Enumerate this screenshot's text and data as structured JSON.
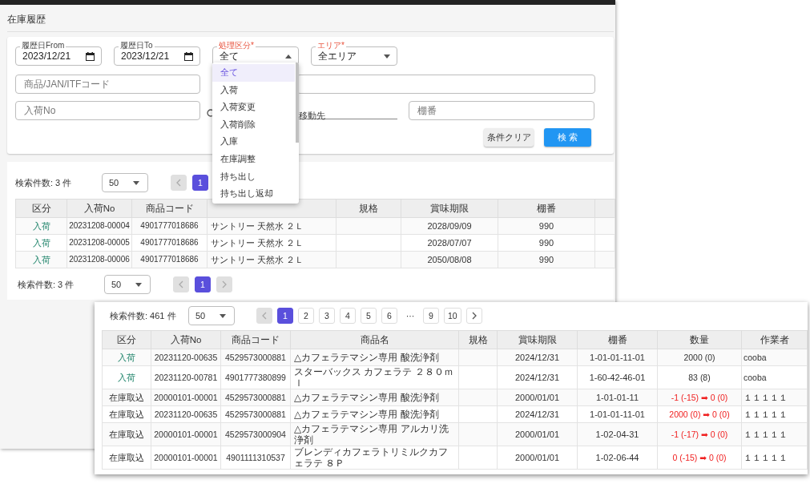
{
  "page": {
    "title": "在庫履歴"
  },
  "filters": {
    "date_from": {
      "label": "履歴日From",
      "value": "2023/12/21"
    },
    "date_to": {
      "label": "履歴日To",
      "value": "2023/12/21"
    },
    "type_select": {
      "label": "処理区分*",
      "required": true,
      "value": "全て",
      "expanded": true
    },
    "area_select": {
      "label": "エリア*",
      "required": true,
      "value": "全エリア",
      "expanded": false
    },
    "product_field": {
      "placeholder": "商品/JAN/ITFコード"
    },
    "receipt_field": {
      "placeholder": "入荷No"
    },
    "destination_field": {
      "value": "移動先"
    },
    "shelf_field": {
      "placeholder": "棚番"
    },
    "clear_button": "条件クリア",
    "search_button": "検 索"
  },
  "type_menu": [
    {
      "label": "全て",
      "selected": true
    },
    {
      "label": "入荷",
      "selected": false
    },
    {
      "label": "入荷変更",
      "selected": false
    },
    {
      "label": "入荷削除",
      "selected": false
    },
    {
      "label": "入庫",
      "selected": false
    },
    {
      "label": "在庫調整",
      "selected": false
    },
    {
      "label": "持ち出し",
      "selected": false
    },
    {
      "label": "持ち出し返却",
      "selected": false
    }
  ],
  "results": {
    "top_bar": {
      "count": "検索件数: 3 件",
      "page_size": "50",
      "prev_disabled": true,
      "pages": [
        {
          "label": "1",
          "selected": true
        }
      ]
    },
    "columns": [
      {
        "label": "区分"
      },
      {
        "label": "入荷No"
      },
      {
        "label": "商品コード"
      },
      {},
      {
        "label": "規格"
      },
      {
        "label": "賞味期限"
      },
      {
        "label": "棚番"
      },
      {}
    ],
    "rows": [
      {
        "kind": "inbound",
        "cells": [
          "入荷",
          "20231208-00004",
          "4901777018686",
          "サントリー 天然水 ２Ｌ",
          "",
          "2028/09/09",
          "990",
          ""
        ]
      },
      {
        "kind": "inbound",
        "cells": [
          "入荷",
          "20231208-00005",
          "4901777018686",
          "サントリー 天然水 ２Ｌ",
          "",
          "2028/07/07",
          "990",
          ""
        ]
      },
      {
        "kind": "inbound",
        "cells": [
          "入荷",
          "20231208-00006",
          "4901777018686",
          "サントリー 天然水 ２Ｌ",
          "",
          "2050/08/08",
          "990",
          ""
        ]
      }
    ],
    "bottom_bar": {
      "count": "検索件数: 3 件",
      "page_size": "50",
      "prev_disabled": true,
      "next_disabled": true,
      "pages": [
        {
          "label": "1",
          "selected": true
        }
      ]
    }
  },
  "overlay_results": {
    "top_bar": {
      "count": "検索件数: 461 件",
      "page_size": "50",
      "prev_disabled": true,
      "next_disabled": false,
      "pages": [
        {
          "label": "1",
          "selected": true
        },
        {
          "label": "2",
          "selected": false
        },
        {
          "label": "3",
          "selected": false
        },
        {
          "label": "4",
          "selected": false
        },
        {
          "label": "5",
          "selected": false
        },
        {
          "label": "6",
          "selected": false
        },
        {
          "label": "···",
          "kind": "ellipsis"
        },
        {
          "label": "9",
          "selected": false
        },
        {
          "label": "10",
          "selected": false
        }
      ]
    },
    "columns": [
      {
        "label": "区分"
      },
      {
        "label": "入荷No"
      },
      {
        "label": "商品コード"
      },
      {
        "label": "商品名"
      },
      {
        "label": "規格"
      },
      {
        "label": "賞味期限"
      },
      {
        "label": "棚番"
      },
      {
        "label": "数量"
      },
      {
        "label": "作業者"
      }
    ],
    "rows": [
      {
        "kind": "inbound",
        "qty_alert": false,
        "cells": [
          "入荷",
          "20231120-00635",
          "4529573000881",
          "△カフェラテマシン専用 酸洗浄剤",
          "",
          "2024/12/31",
          "1-01-01-11-01",
          "2000 (0)",
          "cooba"
        ]
      },
      {
        "kind": "inbound",
        "qty_alert": false,
        "cells": [
          "入荷",
          "20231120-00781",
          "4901777380899",
          "スターバックス カフェラテ ２８０ｍｌ",
          "",
          "2024/12/31",
          "1-60-42-46-01",
          "83 (8)",
          "cooba"
        ]
      },
      {
        "kind": "import",
        "qty_alert": true,
        "cells": [
          "在庫取込",
          "20000101-00001",
          "4529573000881",
          "△カフェラテマシン専用 酸洗浄剤",
          "",
          "2000/01/01",
          "1-01-01-11",
          "-1 (-15) ➡ 0 (0)",
          "１１１１１"
        ]
      },
      {
        "kind": "import",
        "qty_alert": true,
        "cells": [
          "在庫取込",
          "20231120-00635",
          "4529573000881",
          "△カフェラテマシン専用 酸洗浄剤",
          "",
          "2024/12/31",
          "1-01-01-11-01",
          "2000 (0) ➡ 0 (0)",
          "１１１１１"
        ]
      },
      {
        "kind": "import",
        "qty_alert": true,
        "cells": [
          "在庫取込",
          "20000101-00001",
          "4529573000904",
          "△カフェラテマシン専用 アルカリ洗浄剤",
          "",
          "2000/01/01",
          "1-02-04-31",
          "-1 (-17) ➡ 0 (0)",
          "１１１１１"
        ]
      },
      {
        "kind": "import",
        "qty_alert": true,
        "cells": [
          "在庫取込",
          "20000101-00001",
          "4901111310537",
          "ブレンディカフェラトリミルクカフェラテ ８Ｐ",
          "",
          "2000/01/01",
          "1-02-06-44",
          "0 (-15) ➡ 0 (0)",
          "１１１１１"
        ]
      }
    ]
  }
}
